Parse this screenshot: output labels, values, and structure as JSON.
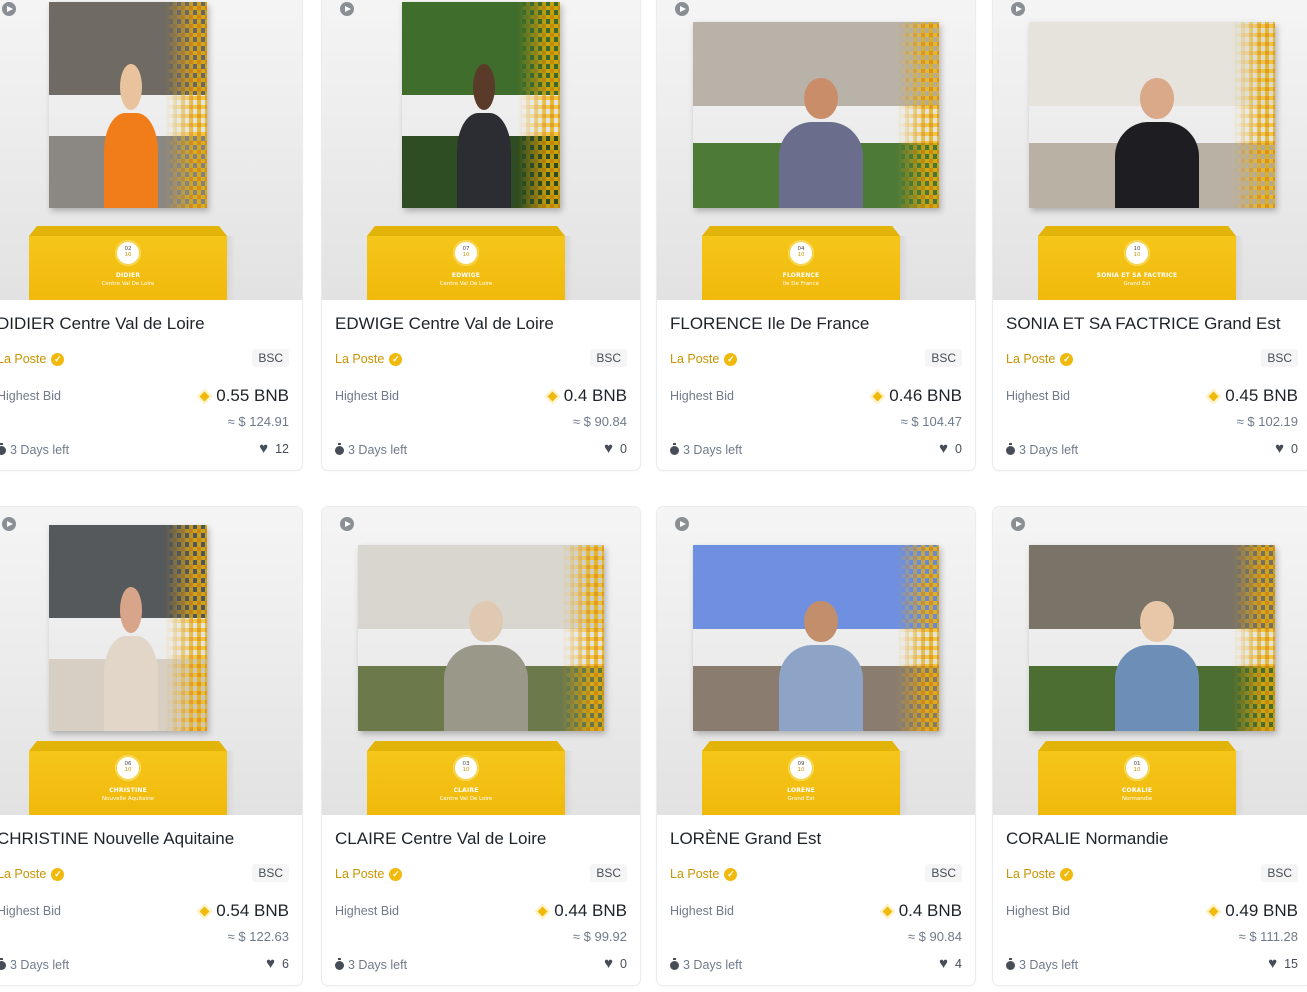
{
  "cards": [
    {
      "title": "DIDIER Centre Val de Loire",
      "creator": "La Poste",
      "chain": "BSC",
      "bid_label": "Highest Bid",
      "price": "0.55 BNB",
      "usd": "≈ $ 124.91",
      "time_left": "3 Days left",
      "likes": "12",
      "badge_num": "02",
      "badge_den": "10",
      "plinth_name": "DIDIER",
      "plinth_region": "Centre Val De Loire",
      "colors": {
        "sky": "#6f6a63",
        "ground": "#8b8782",
        "body": "#f07d1a",
        "head": "#e8c39e"
      }
    },
    {
      "title": "EDWIGE Centre Val de Loire",
      "creator": "La Poste",
      "chain": "BSC",
      "bid_label": "Highest Bid",
      "price": "0.4 BNB",
      "usd": "≈ $ 90.84",
      "time_left": "3 Days left",
      "likes": "0",
      "badge_num": "07",
      "badge_den": "10",
      "plinth_name": "EDWIGE",
      "plinth_region": "Centre Val De Loire",
      "colors": {
        "sky": "#3f6d2c",
        "ground": "#2f4d22",
        "body": "#2b2d33",
        "head": "#5a3a28"
      }
    },
    {
      "title": "FLORENCE Ile De France",
      "creator": "La Poste",
      "chain": "BSC",
      "bid_label": "Highest Bid",
      "price": "0.46 BNB",
      "usd": "≈ $ 104.47",
      "time_left": "3 Days left",
      "likes": "0",
      "badge_num": "04",
      "badge_den": "10",
      "plinth_name": "FLORENCE",
      "plinth_region": "Ile De France",
      "colors": {
        "sky": "#b9b2a8",
        "ground": "#4e7a38",
        "body": "#6a6d8c",
        "head": "#c98d6a"
      }
    },
    {
      "title": "SONIA ET SA FACTRICE Grand Est",
      "creator": "La Poste",
      "chain": "BSC",
      "bid_label": "Highest Bid",
      "price": "0.45 BNB",
      "usd": "≈ $ 102.19",
      "time_left": "3 Days left",
      "likes": "0",
      "badge_num": "10",
      "badge_den": "10",
      "plinth_name": "SONIA ET SA FACTRICE",
      "plinth_region": "Grand Est",
      "colors": {
        "sky": "#e5e3dc",
        "ground": "#b9b1a4",
        "body": "#1d1d22",
        "head": "#d9a98a"
      }
    },
    {
      "title": "CHRISTINE Nouvelle Aquitaine",
      "creator": "La Poste",
      "chain": "BSC",
      "bid_label": "Highest Bid",
      "price": "0.54 BNB",
      "usd": "≈ $ 122.63",
      "time_left": "3 Days left",
      "likes": "6",
      "badge_num": "06",
      "badge_den": "10",
      "plinth_name": "CHRISTINE",
      "plinth_region": "Nouvelle Aquitaine",
      "colors": {
        "sky": "#55595c",
        "ground": "#d8cfc4",
        "body": "#e2d6c8",
        "head": "#d9a58a"
      }
    },
    {
      "title": "CLAIRE Centre Val de Loire",
      "creator": "La Poste",
      "chain": "BSC",
      "bid_label": "Highest Bid",
      "price": "0.44 BNB",
      "usd": "≈ $ 99.92",
      "time_left": "3 Days left",
      "likes": "0",
      "badge_num": "03",
      "badge_den": "10",
      "plinth_name": "CLAIRE",
      "plinth_region": "Centre Val De Loire",
      "colors": {
        "sky": "#d9d6cf",
        "ground": "#6c7a4b",
        "body": "#9a9888",
        "head": "#e0c9b3"
      }
    },
    {
      "title": "LORÈNE Grand Est",
      "creator": "La Poste",
      "chain": "BSC",
      "bid_label": "Highest Bid",
      "price": "0.4 BNB",
      "usd": "≈ $ 90.84",
      "time_left": "3 Days left",
      "likes": "4",
      "badge_num": "09",
      "badge_den": "10",
      "plinth_name": "LORÈNE",
      "plinth_region": "Grand Est",
      "colors": {
        "sky": "#6f8fe0",
        "ground": "#8a7d70",
        "body": "#8ea4c6",
        "head": "#c38e6c"
      }
    },
    {
      "title": "CORALIE Normandie",
      "creator": "La Poste",
      "chain": "BSC",
      "bid_label": "Highest Bid",
      "price": "0.49 BNB",
      "usd": "≈ $ 111.28",
      "time_left": "3 Days left",
      "likes": "15",
      "badge_num": "01",
      "badge_den": "10",
      "plinth_name": "CORALIE",
      "plinth_region": "Normandie",
      "colors": {
        "sky": "#7a7468",
        "ground": "#4d6e32",
        "body": "#6d8fb7",
        "head": "#e8c7a8"
      }
    }
  ]
}
